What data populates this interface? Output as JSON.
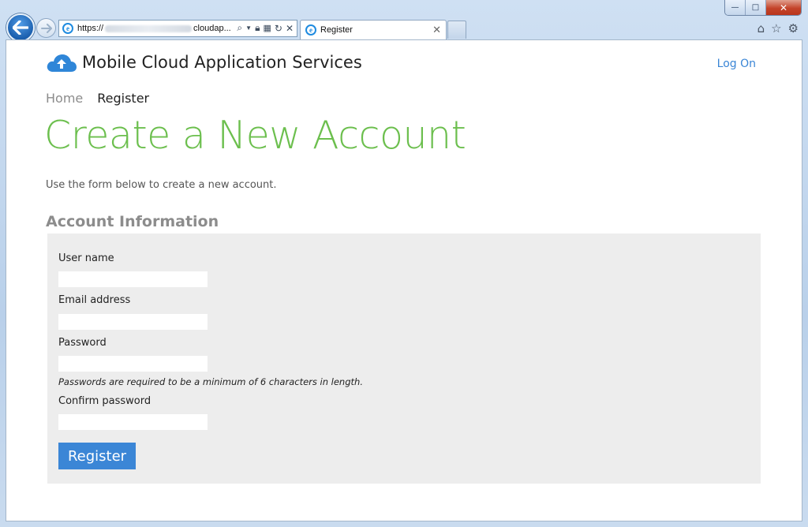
{
  "browser": {
    "address_prefix": "https://",
    "address_suffix": "cloudap...",
    "tab_title": "Register",
    "window_buttons": {
      "minimize": "—",
      "maximize": "□",
      "close": "✕"
    }
  },
  "site": {
    "title": "Mobile Cloud Application Services",
    "login_label": "Log On"
  },
  "breadcrumb": {
    "home": "Home",
    "current": "Register"
  },
  "page": {
    "title": "Create a New Account",
    "intro": "Use the form below to create a new account."
  },
  "form": {
    "section_title": "Account Information",
    "fields": {
      "username_label": "User name",
      "username_value": "",
      "email_label": "Email address",
      "email_value": "",
      "password_label": "Password",
      "password_value": "",
      "password_hint": "Passwords are required to be a minimum of 6 characters in length.",
      "confirm_label": "Confirm password",
      "confirm_value": ""
    },
    "submit_label": "Register"
  },
  "colors": {
    "accent_blue": "#3b86d6",
    "title_green": "#6cbf4e",
    "panel_gray": "#ededed"
  }
}
